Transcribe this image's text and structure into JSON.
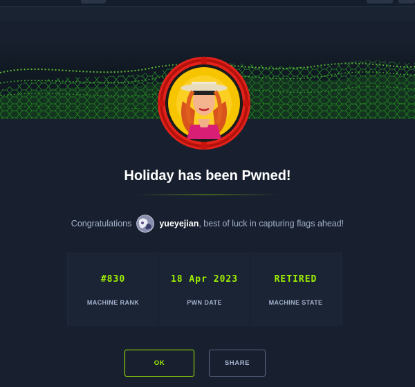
{
  "modal": {
    "title": "Holiday has been Pwned!",
    "congrats_prefix": "Congratulations",
    "username": "yueyejian",
    "congrats_suffix": ", best of luck in capturing flags ahead!"
  },
  "stats": [
    {
      "value": "#830",
      "label": "MACHINE RANK"
    },
    {
      "value": "18 Apr 2023",
      "label": "PWN DATE"
    },
    {
      "value": "RETIRED",
      "label": "MACHINE STATE"
    }
  ],
  "buttons": {
    "ok": "OK",
    "share": "SHARE"
  },
  "colors": {
    "accent": "#9fef00",
    "background": "#1a2332",
    "badge_ring": "#e3221b"
  },
  "icons": {
    "machine_avatar": "holiday-machine-avatar",
    "user_avatar": "user-avatar"
  }
}
